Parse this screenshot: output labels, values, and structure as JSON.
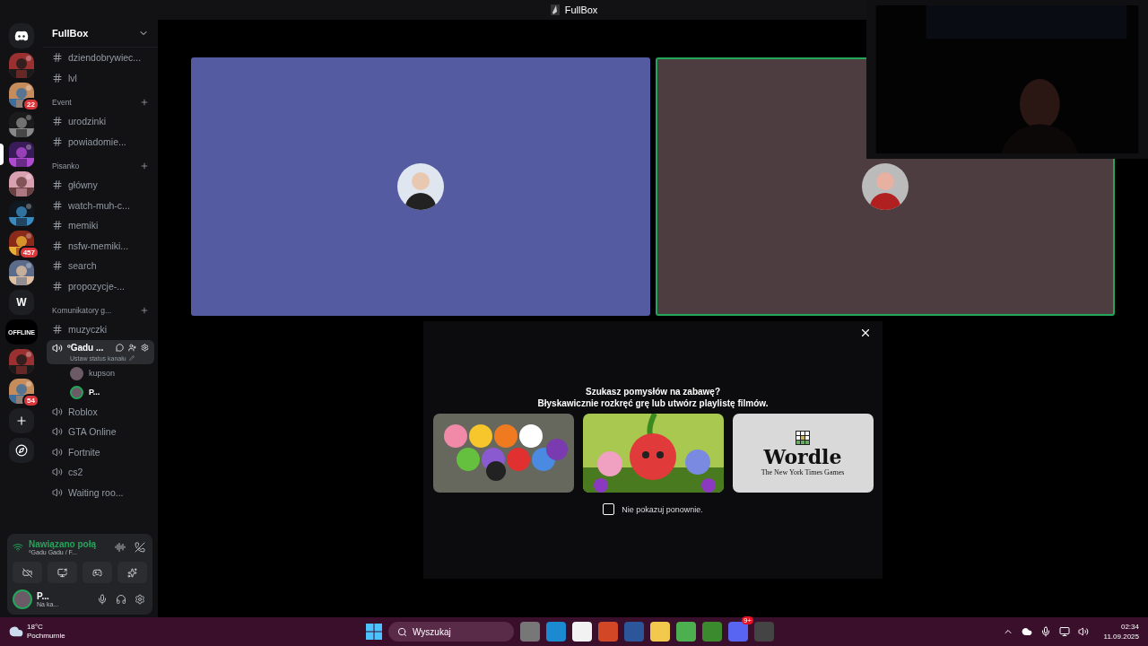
{
  "window": {
    "title": "FullBox"
  },
  "servers": [
    {
      "kind": "logo",
      "selected": false
    },
    {
      "kind": "avatar",
      "selected": false
    },
    {
      "kind": "avatar",
      "badge": "22",
      "selected": false
    },
    {
      "kind": "avatar",
      "selected": false
    },
    {
      "kind": "avatar",
      "selected": true
    },
    {
      "kind": "avatar",
      "selected": false
    },
    {
      "kind": "avatar",
      "selected": false
    },
    {
      "kind": "avatar",
      "badge": "457",
      "selected": false
    },
    {
      "kind": "avatar",
      "selected": false
    },
    {
      "kind": "letter",
      "label": "W",
      "selected": false
    },
    {
      "kind": "letter",
      "label": "OFFLINE",
      "selected": false
    },
    {
      "kind": "avatar",
      "selected": false
    },
    {
      "kind": "avatar",
      "badge": "54",
      "selected": false
    },
    {
      "kind": "add",
      "selected": false
    },
    {
      "kind": "explore",
      "selected": false
    }
  ],
  "server_name": "FullBox",
  "channels": [
    {
      "kind": "text",
      "name": "dziendobrywiec...",
      "selected": false
    },
    {
      "kind": "text",
      "name": "lvl",
      "selected": false
    },
    {
      "kind": "category",
      "name": "Event"
    },
    {
      "kind": "text",
      "name": "urodzinki",
      "selected": false
    },
    {
      "kind": "text",
      "name": "powiadomie...",
      "selected": false
    },
    {
      "kind": "category",
      "name": "Pisanko"
    },
    {
      "kind": "text",
      "name": "główny",
      "selected": false
    },
    {
      "kind": "text",
      "name": "watch-muh-c...",
      "selected": false
    },
    {
      "kind": "text",
      "name": "memiki",
      "selected": false
    },
    {
      "kind": "text",
      "name": "nsfw-memiki...",
      "selected": false
    },
    {
      "kind": "text",
      "name": "search",
      "selected": false
    },
    {
      "kind": "text",
      "name": "propozycje-...",
      "selected": false
    },
    {
      "kind": "category",
      "name": "Komunikatory g..."
    },
    {
      "kind": "text",
      "name": "muzyczki",
      "selected": false
    },
    {
      "kind": "voice",
      "name": "ºGadu ...",
      "status": "Ustaw status kanału",
      "selected": true,
      "children": [
        {
          "name": "kupson",
          "speaking": false
        },
        {
          "name": "P...",
          "speaking": true
        }
      ]
    },
    {
      "kind": "voice",
      "name": "Roblox",
      "selected": false
    },
    {
      "kind": "voice",
      "name": "GTA Online",
      "selected": false
    },
    {
      "kind": "voice",
      "name": "Fortnite",
      "selected": false
    },
    {
      "kind": "voice",
      "name": "cs2",
      "selected": false
    },
    {
      "kind": "voice",
      "name": "Waiting roo...",
      "selected": false
    }
  ],
  "voice_panel": {
    "status": "Nawiązano połą",
    "channel": "ºGadu Gadu / F..."
  },
  "user": {
    "name": "P...",
    "activity": "Na ka..."
  },
  "tiles": [
    {
      "speaking": false
    },
    {
      "speaking": true
    }
  ],
  "activity_popup": {
    "line_1": "Szukasz pomysłów na zabawę?",
    "line_2": "Błyskawicznie rozkręć grę lub utwórz playlistę filmów.",
    "cards": [
      {
        "kind": "picture"
      },
      {
        "kind": "picture"
      },
      {
        "kind": "logo",
        "title": "Wordle",
        "subtitle": "The New York Times Games"
      }
    ],
    "dont_show": {
      "label": "Nie pokazuj ponownie.",
      "checked": false
    }
  },
  "taskbar": {
    "temperature": "18°C",
    "weather": "Pochmurnie",
    "search_placeholder": "Wyszukaj",
    "discord_badge": "9+",
    "time": "02:34",
    "date": "11.09.2025"
  }
}
